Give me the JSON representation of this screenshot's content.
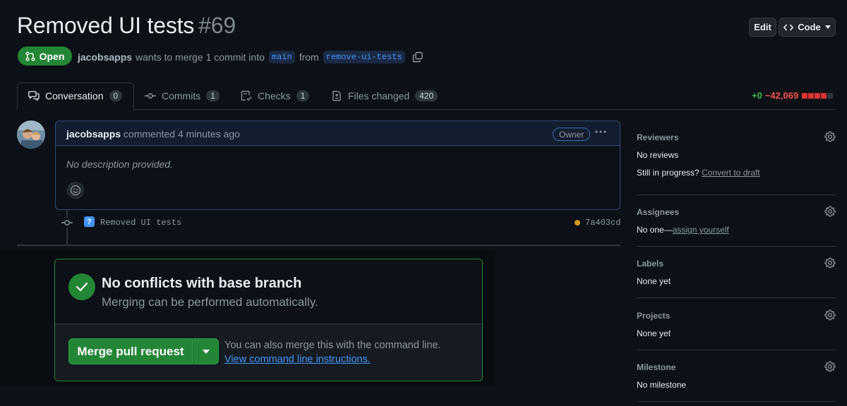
{
  "header": {
    "title": "Removed UI tests",
    "number": "#69",
    "edit_label": "Edit",
    "code_label": "Code"
  },
  "pr_meta": {
    "state": "Open",
    "author": "jacobsapps",
    "merge_text": "wants to merge 1 commit into",
    "base_branch": "main",
    "from_text": "from",
    "head_branch": "remove-ui-tests"
  },
  "tabs": [
    {
      "label": "Conversation",
      "count": "0"
    },
    {
      "label": "Commits",
      "count": "1"
    },
    {
      "label": "Checks",
      "count": "1"
    },
    {
      "label": "Files changed",
      "count": "420"
    }
  ],
  "diffstat": {
    "additions": "+0",
    "deletions": "−42,069"
  },
  "comment": {
    "author": "jacobsapps",
    "action": "commented 4 minutes ago",
    "badge": "Owner",
    "body": "No description provided."
  },
  "commit": {
    "badge": "?",
    "message": "Removed UI tests",
    "sha": "7a403cd"
  },
  "merge_box": {
    "title": "No conflicts with base branch",
    "subtitle": "Merging can be performed automatically.",
    "button_label": "Merge pull request",
    "alt_text": "You can also merge this with the command line.",
    "link_text": "View command line instructions."
  },
  "sidebar": {
    "reviewers": {
      "heading": "Reviewers",
      "value": "No reviews",
      "progress_text": "Still in progress?",
      "progress_link": "Convert to draft"
    },
    "assignees": {
      "heading": "Assignees",
      "value": "No one—",
      "link": "assign yourself"
    },
    "labels": {
      "heading": "Labels",
      "value": "None yet"
    },
    "projects": {
      "heading": "Projects",
      "value": "None yet"
    },
    "milestone": {
      "heading": "Milestone",
      "value": "No milestone"
    }
  },
  "colors": {
    "background": "#0d1117",
    "success": "#238636",
    "accent_link": "#4493f8",
    "danger": "#f85149"
  }
}
